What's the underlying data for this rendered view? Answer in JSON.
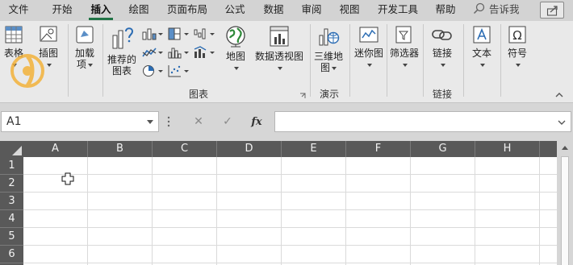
{
  "tabs": [
    {
      "label": "文件",
      "active": false
    },
    {
      "label": "开始",
      "active": false
    },
    {
      "label": "插入",
      "active": true
    },
    {
      "label": "绘图",
      "active": false
    },
    {
      "label": "页面布局",
      "active": false
    },
    {
      "label": "公式",
      "active": false
    },
    {
      "label": "数据",
      "active": false
    },
    {
      "label": "审阅",
      "active": false
    },
    {
      "label": "视图",
      "active": false
    },
    {
      "label": "开发工具",
      "active": false
    },
    {
      "label": "帮助",
      "active": false
    }
  ],
  "tell_me": "告诉我",
  "ribbon": {
    "tables": {
      "label1": "表格",
      "icon": "table-icon"
    },
    "illustrations": {
      "label1": "插图",
      "icon": "picture-icon"
    },
    "addins": {
      "label1": "加载",
      "label2": "项",
      "icon": "addin-icon"
    },
    "recommended_charts": {
      "label1": "推荐的",
      "label2": "图表",
      "icon": "recommended-charts-icon"
    },
    "maps": {
      "label1": "地图",
      "icon": "globe-icon"
    },
    "pivot_chart": {
      "label1": "数据透视图",
      "icon": "pivot-chart-icon"
    },
    "map3d": {
      "label1": "三维地",
      "label2": "图",
      "icon": "3d-map-icon"
    },
    "sparklines": {
      "label1": "迷你图",
      "icon": "sparkline-icon"
    },
    "filters": {
      "label1": "筛选器",
      "icon": "filter-icon"
    },
    "links": {
      "label1": "链接",
      "icon": "link-icon"
    },
    "text": {
      "label1": "文本",
      "icon": "text-icon"
    },
    "symbols": {
      "label1": "符号",
      "icon": "omega-icon"
    },
    "group_labels": {
      "charts": "图表",
      "tours": "演示",
      "links": "链接"
    }
  },
  "formula_bar": {
    "name_box": "A1",
    "value": ""
  },
  "grid": {
    "columns": [
      "A",
      "B",
      "C",
      "D",
      "E",
      "F",
      "G",
      "H"
    ],
    "rows": [
      "1",
      "2",
      "3",
      "4",
      "5",
      "6"
    ]
  },
  "colors": {
    "accent": "#217346",
    "header_bg": "#595959"
  }
}
